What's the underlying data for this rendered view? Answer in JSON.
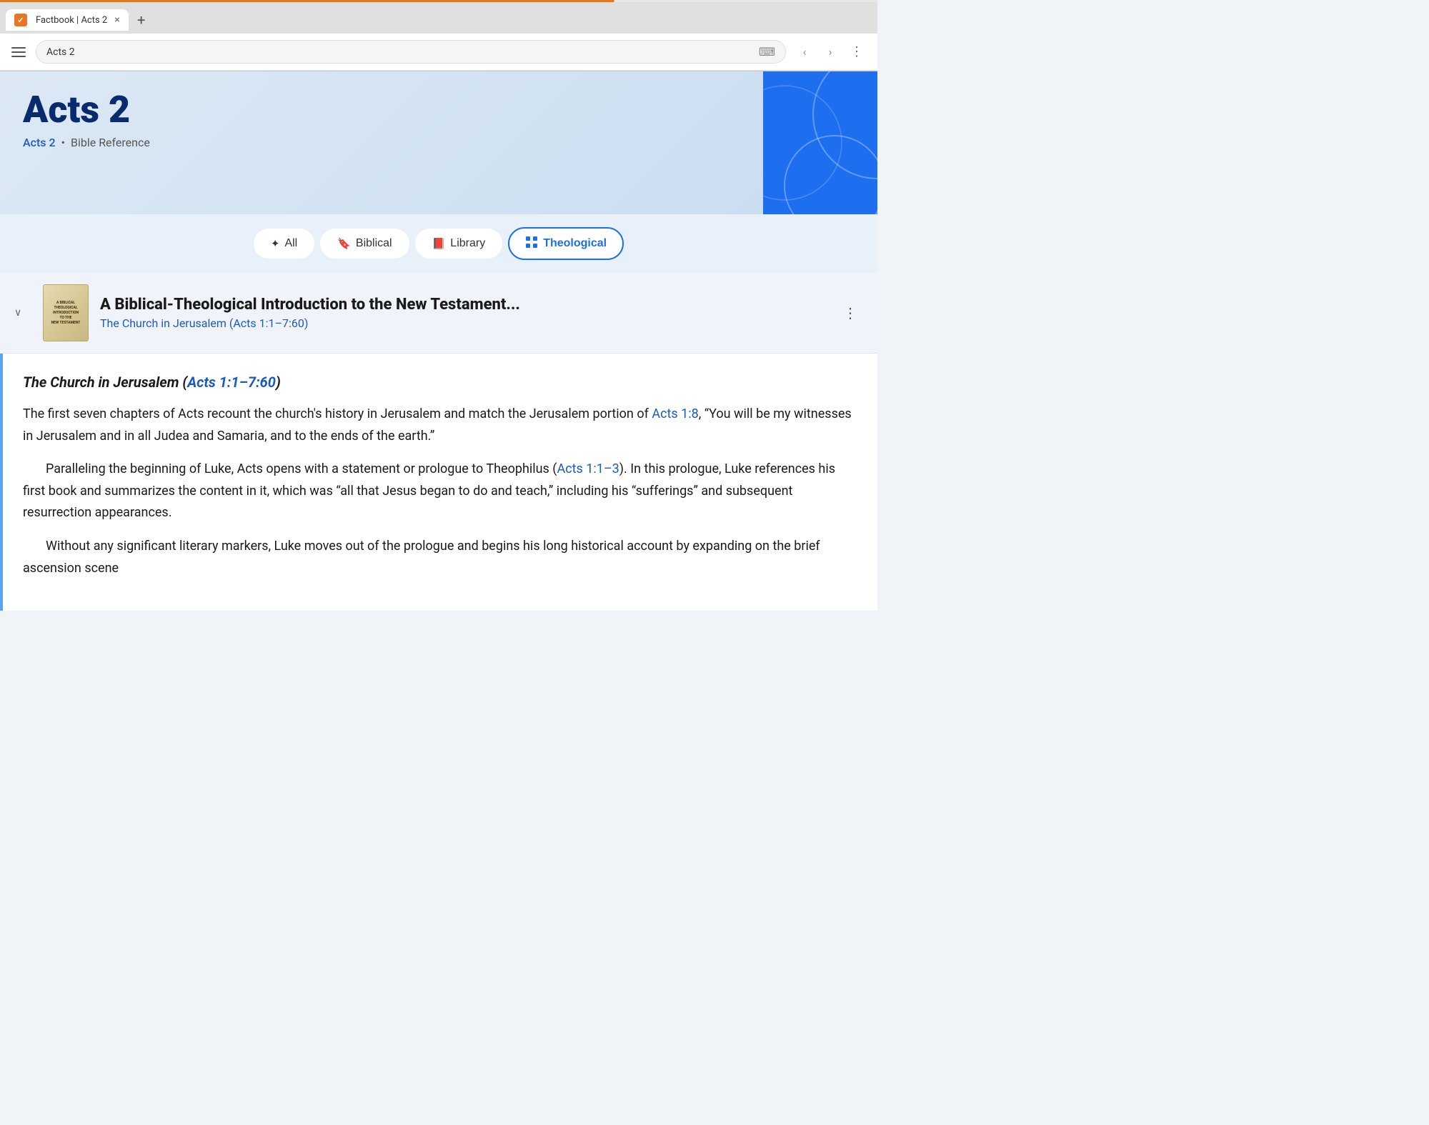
{
  "browser": {
    "tab_label": "Factbook | Acts 2",
    "tab_close": "×",
    "tab_new": "+",
    "address_value": "Acts 2",
    "keyboard_icon": "⌨",
    "nav_back": "‹",
    "nav_forward": "›",
    "nav_menu": "⋮"
  },
  "header": {
    "title": "Acts 2",
    "breadcrumb_link": "Acts 2",
    "breadcrumb_separator": "•",
    "breadcrumb_text": "Bible Reference"
  },
  "filters": {
    "all_label": "All",
    "biblical_label": "Biblical",
    "library_label": "Library",
    "theological_label": "Theological"
  },
  "book_entry": {
    "title": "A Biblical-Theological Introduction to the New Testament...",
    "subtitle": "The Church in Jerusalem (Acts 1:1–7:60)",
    "cover_lines": [
      "A BIBLICAL",
      "THEOLOGICAL",
      "INTRODUCTION",
      "TO THE",
      "NEW TESTAMENT"
    ]
  },
  "reading": {
    "heading_text": "The Church in Jerusalem (",
    "heading_link_text": "Acts 1:1–7:60",
    "heading_end": ")",
    "paragraph1": "The first seven chapters of Acts recount the church's history in Jerusalem and match the Jerusalem portion of ",
    "paragraph1_link": "Acts 1:8",
    "paragraph1_cont": ", “You will be my witnesses in Jerusalem and in all Judea and Samaria, and to the ends of the earth.”",
    "paragraph2_indent": "Paralleling the beginning of Luke, Acts opens with a statement or prologue to Theophilus (",
    "paragraph2_link": "Acts 1:1–3",
    "paragraph2_cont": "). In this prologue, Luke references his first book and summarizes the content in it, which was “all that Jesus began to do and teach,” including his “sufferings” and subsequent resurrection appearances.",
    "paragraph3_indent": "Without any significant literary markers, Luke moves out of the prologue and begins his long historical account by expanding on the brief ascension scene"
  }
}
